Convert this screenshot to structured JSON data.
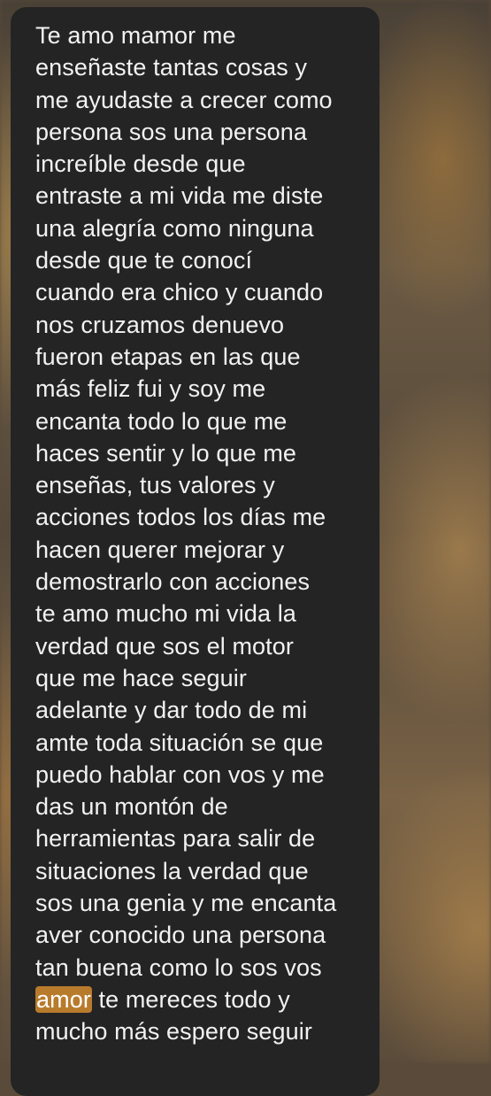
{
  "message": {
    "lines": [
      "Te amo mamor me",
      "enseñaste tantas cosas y",
      "me ayudaste a crecer como",
      "persona sos una persona",
      "increíble desde que",
      "entraste a mi vida me diste",
      "una alegría como ninguna",
      "desde que te conocí",
      "cuando era chico y cuando",
      "nos cruzamos denuevo",
      "fueron etapas en las que",
      "más feliz fui y soy me",
      "encanta todo lo que me",
      "haces sentir y lo que me",
      "enseñas, tus valores y",
      "acciones todos los días me",
      "hacen querer mejorar y",
      "demostrarlo con acciones",
      "te amo mucho mi vida la",
      "verdad que sos el motor",
      "que me hace seguir",
      "adelante y dar todo de mi",
      "amte toda situación se que",
      "puedo hablar con vos y me",
      "das un montón de",
      "herramientas para salir de",
      "situaciones la verdad que",
      "sos una genia y me encanta",
      "aver conocido una persona",
      "tan buena como lo sos vos"
    ],
    "highlighted_word": "amor",
    "line_after_highlight": " te mereces todo y",
    "last_line": "mucho más espero seguir"
  },
  "colors": {
    "bubble_background": "#242424",
    "text": "#f2f2f2",
    "highlight": "#b87b2c"
  }
}
